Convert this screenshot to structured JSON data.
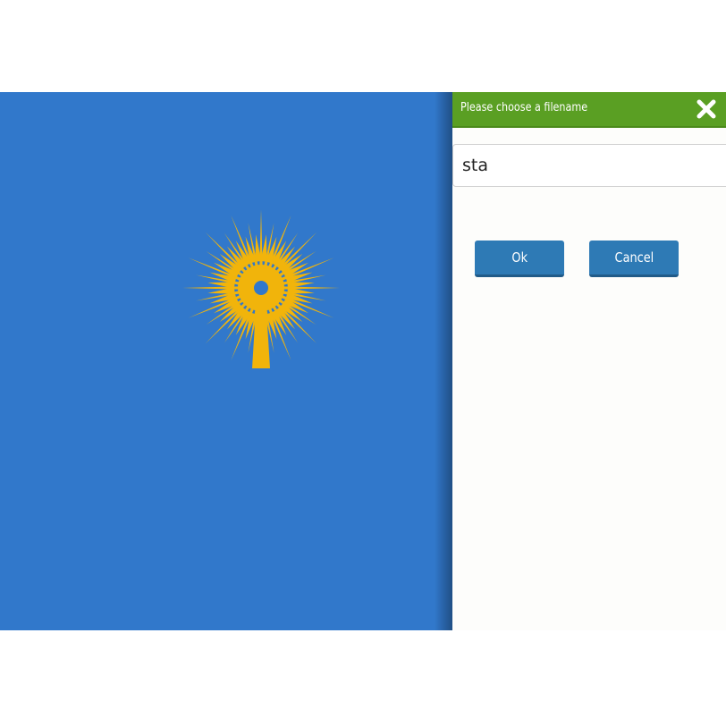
{
  "dialog": {
    "title": "Please choose a filename",
    "filename_value": "sta",
    "ok_label": "Ok",
    "cancel_label": "Cancel",
    "close_icon": "close-icon"
  },
  "canvas": {
    "background_color": "#3178cb",
    "drawing": {
      "icon": "sun-icon",
      "color": "#f1b40b"
    }
  },
  "colors": {
    "header": "#5a9f23",
    "button": "#2e7ab5"
  }
}
